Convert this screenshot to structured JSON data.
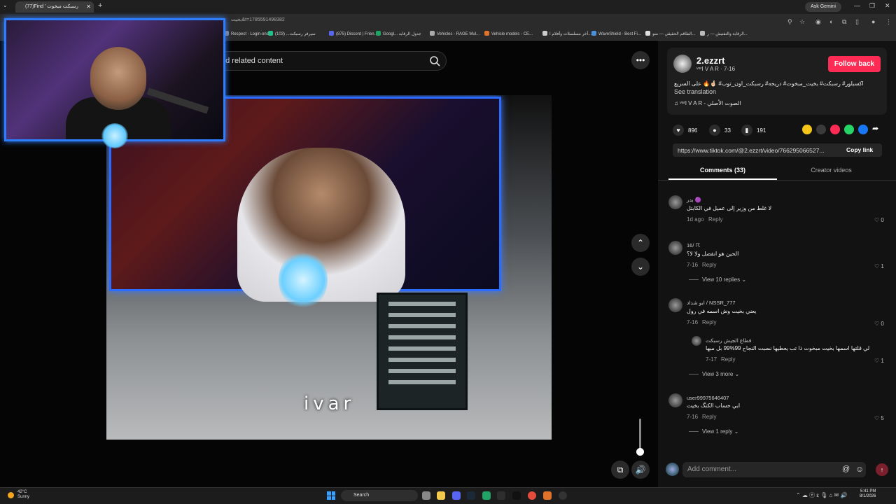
{
  "browser": {
    "tab_title": "(77)Find ' رسبكت مبخوت",
    "new_tab": "+",
    "ask_gemini": "Ask Gemini",
    "url_fragment": "بخيت&t=1785591498382",
    "bookmarks": [
      {
        "label": "Respect - Login-one",
        "color": "#888888"
      },
      {
        "label": "سيرفر رسبكت... (103)",
        "color": "#21c18a"
      },
      {
        "label": "(875) Discord | Frien...",
        "color": "#5865f2"
      },
      {
        "label": "Googl... جدول الرقابه",
        "color": "#1fa463"
      },
      {
        "label": "Vehicles - RAGE Mul...",
        "color": "#aaaaaa"
      },
      {
        "label": "Vehicle models - CE...",
        "color": "#e0732b"
      },
      {
        "label": "أخر مسلسلات وأفلام ا...",
        "color": "#cccccc"
      },
      {
        "label": "WaveShield - Best Fi...",
        "color": "#4a90d9"
      },
      {
        "label": "الطاقم الحقيقي — منو...",
        "color": "#dddddd"
      },
      {
        "label": "الرقابة والتفتيش — ر...",
        "color": "#bbbbbb"
      }
    ]
  },
  "left": {
    "search_placeholder": "nd related content",
    "video_caption": "ivar"
  },
  "post": {
    "username": "2.ezzrt",
    "subtitle": "ᵛᵃʳI V A R · 7-16",
    "follow_label": "Follow back",
    "description": "اكسبلور# رسبكت# بخيت_مبخوت# دريحه# رسبكت_اون_توب# 🤞🏻🔥 على السريع",
    "see_translation": "See translation",
    "sound": "♫  ᵛᵃʳI V A R - الصوت الأصلي",
    "likes": "896",
    "comments": "33",
    "saves": "191",
    "link": "https://www.tiktok.com/@2.ezzrt/video/766295066527...",
    "copy_link": "Copy link",
    "tab_comments": "Comments (33)",
    "tab_creator": "Creator videos"
  },
  "comments": [
    {
      "name": "بدر 🟣",
      "text": "لا غلط من وزير إلى عميل في الكابتل",
      "date": "1d ago",
      "reply": "Reply",
      "likes": "0"
    },
    {
      "name": "16/ ☈",
      "text": "الحين هو انفصل ولا لا؟",
      "date": "7-16",
      "reply": "Reply",
      "likes": "1",
      "view": "View 10 replies ⌄"
    },
    {
      "name": "ابو شداد / NSSR_777",
      "text": "يعني بخيت وش اسمه في رول",
      "date": "7-16",
      "reply": "Reply",
      "likes": "0"
    },
    {
      "name": "قطاع الجيش رسبكت",
      "text": "لي قلتها اسمها بخيت مبخوت ذا تب يعطيها نسبت النجاح 99%99 بل مبها",
      "date": "7-17",
      "reply": "Reply",
      "likes": "1",
      "view": "View 3 more ⌄"
    },
    {
      "name": "user99975646407",
      "text": "ابي حساب الكنگ بخيت",
      "date": "7-16",
      "reply": "Reply",
      "likes": "5",
      "view": "View 1 reply ⌄"
    }
  ],
  "comment_box": {
    "placeholder": "Add comment...",
    "at": "@",
    "emoji": "☺",
    "post": "↑"
  },
  "taskbar": {
    "temp": "42°C",
    "weather": "Sunny",
    "search": "Search",
    "tray": "⌃  ☁  ⓔ  ε  🎙  ⌂  ✉  🔊",
    "time": "5:41 PM",
    "date": "8/1/2026"
  }
}
